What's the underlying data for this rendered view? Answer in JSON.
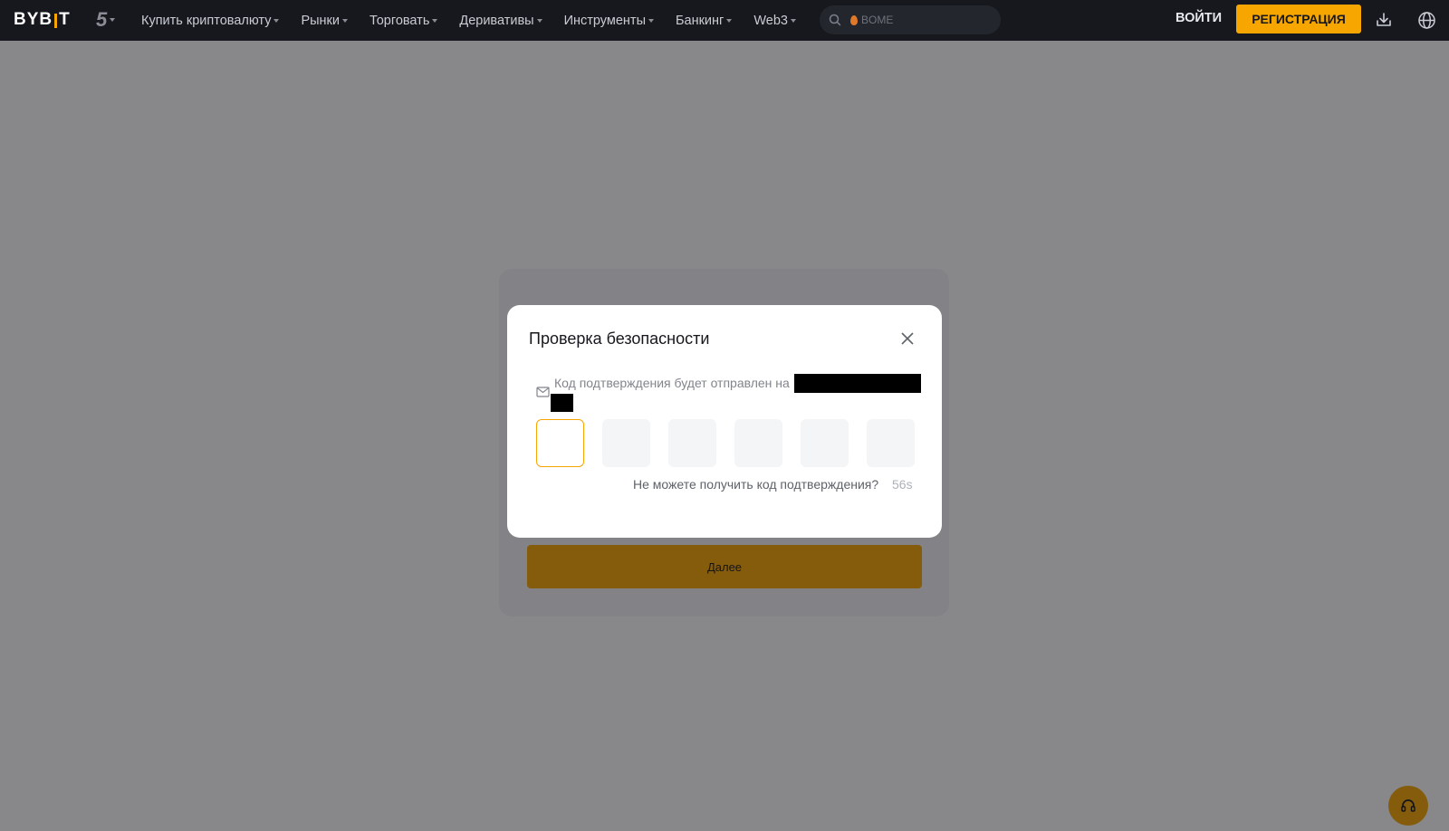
{
  "header": {
    "logo_text": "BYBIT",
    "logo_left": "BYB",
    "logo_right": "T",
    "five_badge": "5",
    "nav": [
      {
        "label": "Купить криптовалюту"
      },
      {
        "label": "Рынки"
      },
      {
        "label": "Торговать"
      },
      {
        "label": "Деривативы"
      },
      {
        "label": "Инструменты"
      },
      {
        "label": "Банкинг"
      },
      {
        "label": "Web3"
      }
    ],
    "search_placeholder": "BOME",
    "login_label": "ВОЙТИ",
    "register_label": "РЕГИСТРАЦИЯ",
    "icons": [
      "download-icon",
      "globe-icon"
    ]
  },
  "background": {
    "next_button_label": "Далее"
  },
  "modal": {
    "title": "Проверка безопасности",
    "info_text": "Код подтверждения будет отправлен на",
    "code_length": 6,
    "resend_text": "Не можете получить код подтверждения?",
    "timer": "56s"
  },
  "colors": {
    "accent": "#f7a600",
    "topbar": "#17181e",
    "overlay": "rgba(17,18,24,0.5)"
  }
}
